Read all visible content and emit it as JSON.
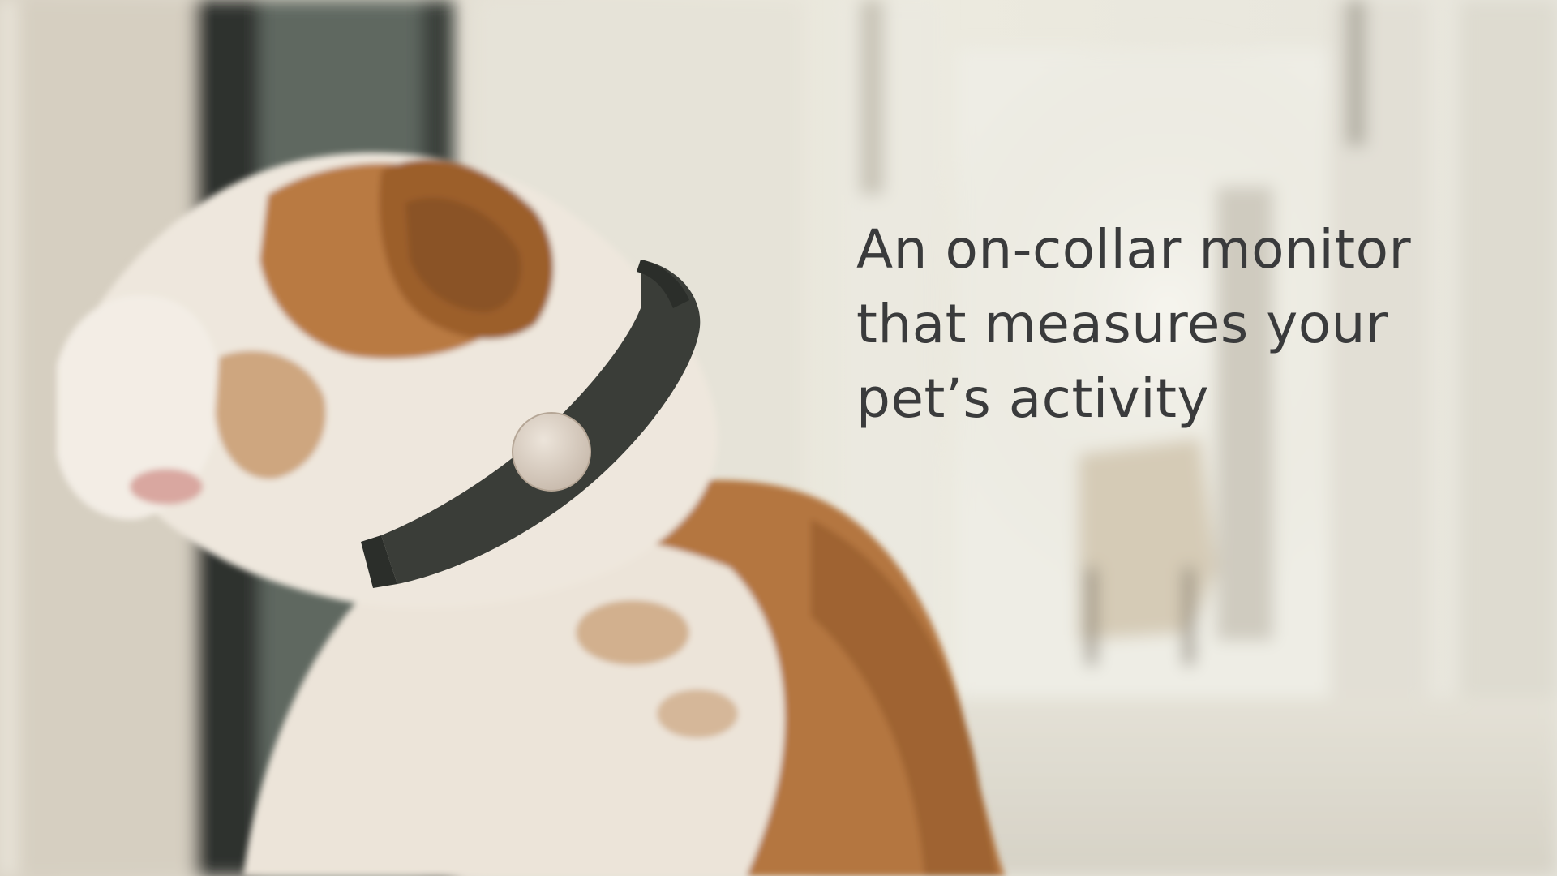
{
  "caption": {
    "lines": [
      "An on-collar monitor",
      "that measures your",
      "pet’s activity"
    ]
  },
  "scene": {
    "subject": "bulldog-wearing-collar-monitor",
    "palette": {
      "wall": "#e8e5da",
      "window_frame": "#2f3330",
      "fur_brown": "#b5773f",
      "fur_white": "#efe8df",
      "collar": "#3a3d38",
      "monitor_disc": "#d9cfc4",
      "caption_text": "#3a3b3c"
    }
  }
}
